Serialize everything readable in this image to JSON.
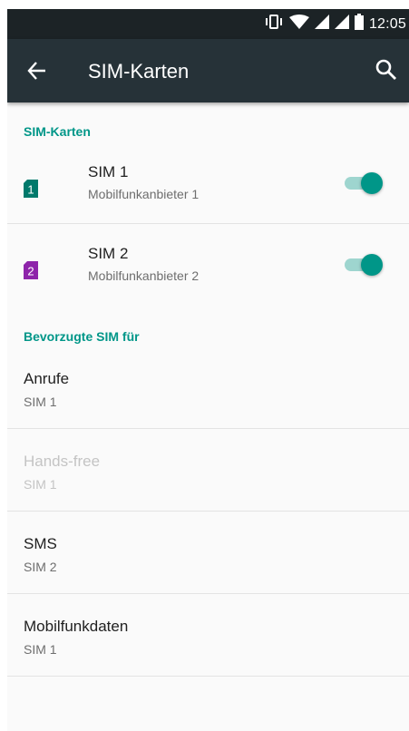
{
  "status_bar": {
    "time": "12:05",
    "icons": [
      "vibrate-icon",
      "wifi-icon",
      "signal-sim1-icon",
      "signal-sim2-icon",
      "battery-icon"
    ]
  },
  "app_bar": {
    "title": "SIM-Karten",
    "back_icon": "arrow-left-icon",
    "search_icon": "search-icon"
  },
  "sim_section": {
    "header": "SIM-Karten",
    "sims": [
      {
        "slot": "1",
        "title": "SIM 1",
        "subtitle": "Mobilfunkanbieter 1",
        "enabled": true,
        "color": "#00796b"
      },
      {
        "slot": "2",
        "title": "SIM 2",
        "subtitle": "Mobilfunkanbieter 2",
        "enabled": true,
        "color": "#8e24aa"
      }
    ]
  },
  "preferred_section": {
    "header": "Bevorzugte SIM für",
    "items": [
      {
        "title": "Anrufe",
        "value": "SIM 1",
        "disabled": false
      },
      {
        "title": "Hands-free",
        "value": "SIM 1",
        "disabled": true
      },
      {
        "title": "SMS",
        "value": "SIM 2",
        "disabled": false
      },
      {
        "title": "Mobilfunkdaten",
        "value": "SIM 1",
        "disabled": false
      }
    ]
  },
  "colors": {
    "accent": "#009688",
    "app_bar": "#263238",
    "status_bar": "#1c2326"
  }
}
